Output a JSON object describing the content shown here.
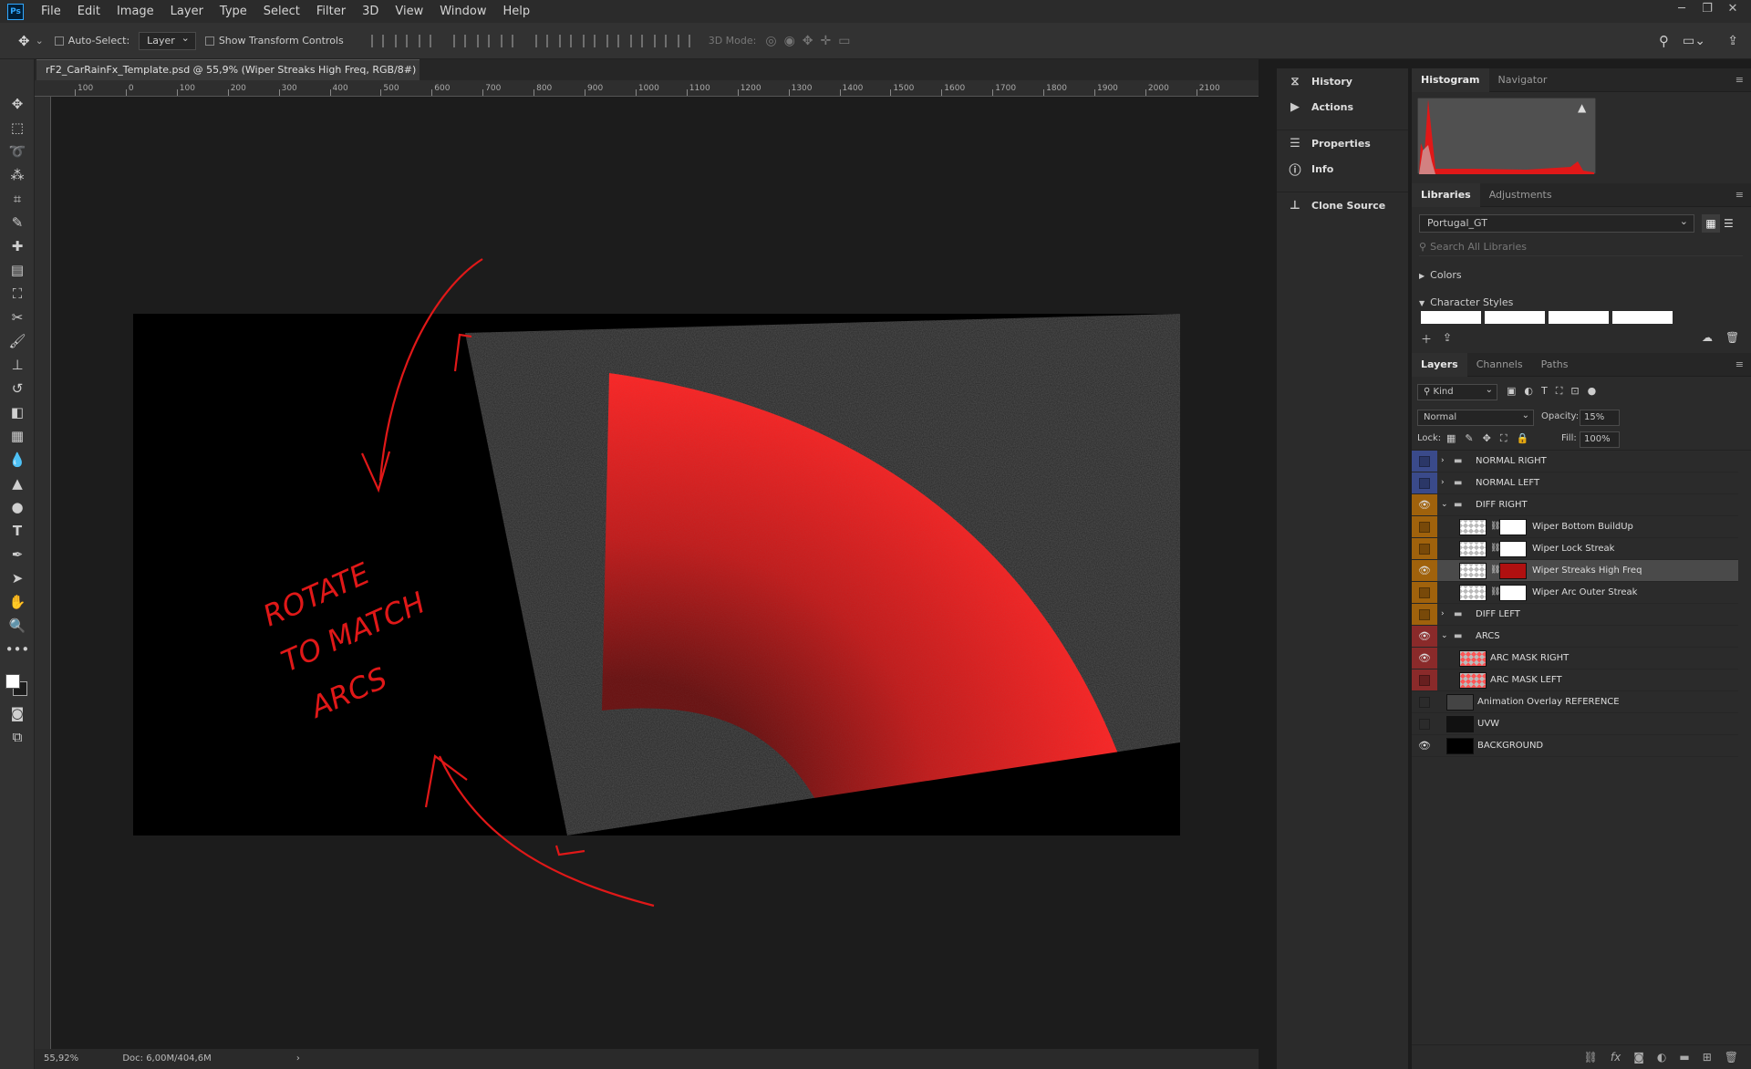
{
  "app": {
    "logo": "Ps"
  },
  "menu": [
    "File",
    "Edit",
    "Image",
    "Layer",
    "Type",
    "Select",
    "Filter",
    "3D",
    "View",
    "Window",
    "Help"
  ],
  "options": {
    "auto_select_label": "Auto-Select:",
    "auto_select_value": "Layer",
    "show_transform_label": "Show Transform Controls",
    "mode_3d_label": "3D Mode:"
  },
  "document": {
    "tab_title": "rF2_CarRainFx_Template.psd @ 55,9% (Wiper Streaks High Freq, RGB/8#) *",
    "close": "×"
  },
  "ruler": {
    "h_labels": [
      "100",
      "0",
      "100",
      "200",
      "300",
      "400",
      "500",
      "600",
      "700",
      "800",
      "900",
      "1000",
      "1100",
      "1200",
      "1300",
      "1400",
      "1500",
      "1600",
      "1700",
      "1800",
      "1900",
      "2000",
      "2100"
    ]
  },
  "status": {
    "zoom": "55,92%",
    "doc": "Doc: 6,00M/404,6M",
    "arrow": "›"
  },
  "annotation": {
    "line1": "ROTATE",
    "line2": "TO MATCH",
    "line3": "ARCS"
  },
  "collapsed_panels": [
    {
      "label": "History",
      "icon": "history-icon"
    },
    {
      "label": "Actions",
      "icon": "play-icon"
    },
    {
      "label": "Properties",
      "icon": "properties-icon"
    },
    {
      "label": "Info",
      "icon": "info-icon"
    },
    {
      "label": "Clone Source",
      "icon": "clone-source-icon"
    }
  ],
  "histogram_tabs": [
    "Histogram",
    "Navigator"
  ],
  "libraries": {
    "tabs": [
      "Libraries",
      "Adjustments"
    ],
    "selected_library": "Portugal_GT",
    "search_placeholder": "Search All Libraries",
    "sections": [
      "Colors",
      "Character Styles"
    ]
  },
  "layers_panel": {
    "tabs": [
      "Layers",
      "Channels",
      "Paths"
    ],
    "filter_kind": "Kind",
    "blend_mode": "Normal",
    "opacity_label": "Opacity:",
    "opacity_value": "15%",
    "lock_label": "Lock:",
    "fill_label": "Fill:",
    "fill_value": "100%",
    "layers": [
      {
        "name": "NORMAL RIGHT",
        "type": "group",
        "indent": 0,
        "visible": false,
        "color": "#3a4a8a",
        "expanded": false
      },
      {
        "name": "NORMAL LEFT",
        "type": "group",
        "indent": 0,
        "visible": false,
        "color": "#3a4a8a",
        "expanded": false
      },
      {
        "name": "DIFF RIGHT",
        "type": "group",
        "indent": 0,
        "visible": true,
        "color": "#a0620c",
        "expanded": true
      },
      {
        "name": "Wiper Bottom BuildUp",
        "type": "masked",
        "indent": 1,
        "visible": false,
        "color": "#a0620c"
      },
      {
        "name": "Wiper Lock Streak",
        "type": "masked",
        "indent": 1,
        "visible": false,
        "color": "#a0620c"
      },
      {
        "name": "Wiper Streaks High Freq",
        "type": "masked",
        "indent": 1,
        "visible": true,
        "color": "#a0620c",
        "selected": true
      },
      {
        "name": "Wiper Arc Outer Streak",
        "type": "masked",
        "indent": 1,
        "visible": false,
        "color": "#a0620c"
      },
      {
        "name": "DIFF LEFT",
        "type": "group",
        "indent": 0,
        "visible": false,
        "color": "#a0620c",
        "expanded": false
      },
      {
        "name": "ARCS",
        "type": "group",
        "indent": 0,
        "visible": true,
        "color": "#8a2a2a",
        "expanded": true
      },
      {
        "name": "ARC MASK RIGHT",
        "type": "red",
        "indent": 1,
        "visible": true,
        "color": "#8a2a2a"
      },
      {
        "name": "ARC MASK LEFT",
        "type": "red",
        "indent": 1,
        "visible": false,
        "color": "#8a2a2a"
      },
      {
        "name": "Animation Overlay REFERENCE",
        "type": "pixel",
        "indent": 0,
        "visible": false,
        "color": ""
      },
      {
        "name": "UVW",
        "type": "dark",
        "indent": 0,
        "visible": false,
        "color": ""
      },
      {
        "name": "BACKGROUND",
        "type": "black",
        "indent": 0,
        "visible": true,
        "color": ""
      }
    ]
  }
}
